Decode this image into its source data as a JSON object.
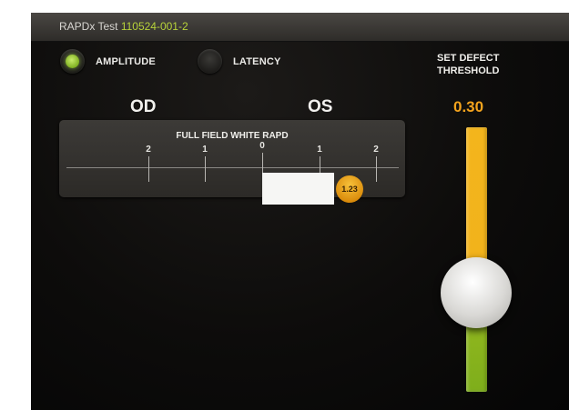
{
  "window": {
    "title_prefix": "RAPDx Test",
    "test_id": "110524-001-2"
  },
  "mode": {
    "amplitude_label": "AMPLITUDE",
    "latency_label": "LATENCY",
    "selected": "AMPLITUDE"
  },
  "eyes": {
    "left": "OD",
    "right": "OS"
  },
  "rapd_panel": {
    "title": "FULL FIELD WHITE RAPD",
    "ticks": [
      "2",
      "1",
      "0",
      "1",
      "2"
    ],
    "result": "1.23"
  },
  "threshold": {
    "label_line1": "SET DEFECT",
    "label_line2": "THRESHOLD",
    "value": "0.30",
    "slider_level": 0.3
  },
  "colors": {
    "accent_orange": "#f3a31d",
    "status_green": "#9acd32",
    "id_green": "#b7d23a"
  }
}
